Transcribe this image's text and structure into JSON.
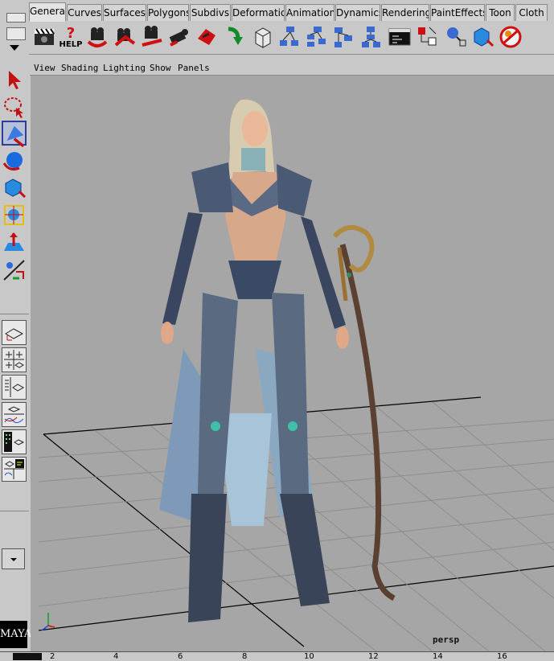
{
  "shelf": {
    "tabs": [
      "General",
      "Curves",
      "Surfaces",
      "Polygons",
      "Subdivs",
      "Deformation",
      "Animation",
      "Dynamics",
      "Rendering",
      "PaintEffects",
      "Toon",
      "Cloth"
    ],
    "active_tab": "General",
    "help_label": "HELP"
  },
  "icons": {
    "shelf": [
      "clapboard-icon",
      "help-icon",
      "camera-undo-icon",
      "camera-tumble-icon",
      "camera-track-icon",
      "camera-dolly-icon",
      "camera-aim-icon",
      "redo-arrow-icon",
      "cube-icon",
      "hierarchy-icon",
      "hierarchy-icon",
      "hierarchy-icon",
      "hierarchy-icon",
      "script-editor-icon",
      "connection-icon",
      "sphere-node-icon",
      "cube-node-icon",
      "render-gear-icon"
    ],
    "toolbox": [
      "select-arrow-icon",
      "lasso-icon",
      "paint-select-icon",
      "rotate-icon",
      "scale-icon",
      "manipulator-icon",
      "soft-mod-icon",
      "show-manipulator-icon"
    ]
  },
  "panel_menu": [
    "View",
    "Shading",
    "Lighting",
    "Show",
    "Panels"
  ],
  "viewport": {
    "camera_label": "persp",
    "background_color": "#a6a6a6",
    "grid_color": "#000000"
  },
  "timeline": {
    "ticks": [
      "2",
      "4",
      "6",
      "8",
      "10",
      "12",
      "14",
      "16"
    ]
  },
  "logo_text": "MAYA"
}
